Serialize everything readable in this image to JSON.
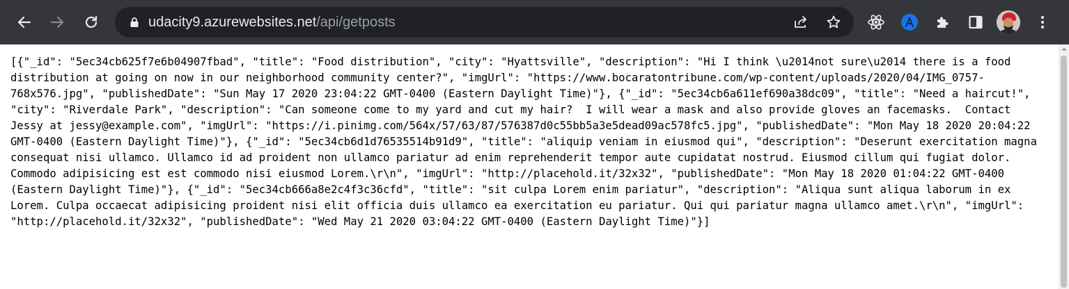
{
  "browser": {
    "url_host": "udacity9.azurewebsites.net",
    "url_path": "/api/getposts",
    "icons": {
      "back": "back-arrow-icon",
      "forward": "forward-arrow-icon",
      "reload": "reload-icon",
      "lock": "lock-icon",
      "share": "share-icon",
      "bookmark": "star-icon",
      "ext_react": "react-devtools-icon",
      "ext_translate": "translate-extension-icon",
      "extensions": "puzzle-icon",
      "side_panel": "side-panel-icon",
      "profile": "avatar",
      "menu": "kebab-menu-icon"
    },
    "colors": {
      "toolbar_bg": "#35363a",
      "omnibox_bg": "#202124",
      "url_host": "#e8eaed",
      "url_path": "#9aa0a6",
      "icon": "#e8eaed",
      "translate_ext": "#1a73e8"
    }
  },
  "page": {
    "body_text": "[{\"_id\": \"5ec34cb625f7e6b04907fbad\", \"title\": \"Food distribution\", \"city\": \"Hyattsville\", \"description\": \"Hi I think \\u2014not sure\\u2014 there is a food distribution at going on now in our neighborhood community center?\", \"imgUrl\": \"https://www.bocaratontribune.com/wp-content/uploads/2020/04/IMG_0757-768x576.jpg\", \"publishedDate\": \"Sun May 17 2020 23:04:22 GMT-0400 (Eastern Daylight Time)\"}, {\"_id\": \"5ec34cb6a611ef690a38dc09\", \"title\": \"Need a haircut!\", \"city\": \"Riverdale Park\", \"description\": \"Can someone come to my yard and cut my hair?  I will wear a mask and also provide gloves an facemasks.  Contact Jessy at jessy@example.com\", \"imgUrl\": \"https://i.pinimg.com/564x/57/63/87/576387d0c55bb5a3e5dead09ac578fc5.jpg\", \"publishedDate\": \"Mon May 18 2020 20:04:22 GMT-0400 (Eastern Daylight Time)\"}, {\"_id\": \"5ec34cb6d1d76535514b91d9\", \"title\": \"aliquip veniam in eiusmod qui\", \"description\": \"Deserunt exercitation magna consequat nisi ullamco. Ullamco id ad proident non ullamco pariatur ad enim reprehenderit tempor aute cupidatat nostrud. Eiusmod cillum qui fugiat dolor. Commodo adipisicing est est commodo nisi eiusmod Lorem.\\r\\n\", \"imgUrl\": \"http://placehold.it/32x32\", \"publishedDate\": \"Mon May 18 2020 01:04:22 GMT-0400 (Eastern Daylight Time)\"}, {\"_id\": \"5ec34cb666a8e2c4f3c36cfd\", \"title\": \"sit culpa Lorem enim pariatur\", \"description\": \"Aliqua sunt aliqua laborum in ex Lorem. Culpa occaecat adipisicing proident nisi elit officia duis ullamco ea exercitation eu pariatur. Qui qui pariatur magna ullamco amet.\\r\\n\", \"imgUrl\": \"http://placehold.it/32x32\", \"publishedDate\": \"Wed May 21 2020 03:04:22 GMT-0400 (Eastern Daylight Time)\"}]"
  }
}
